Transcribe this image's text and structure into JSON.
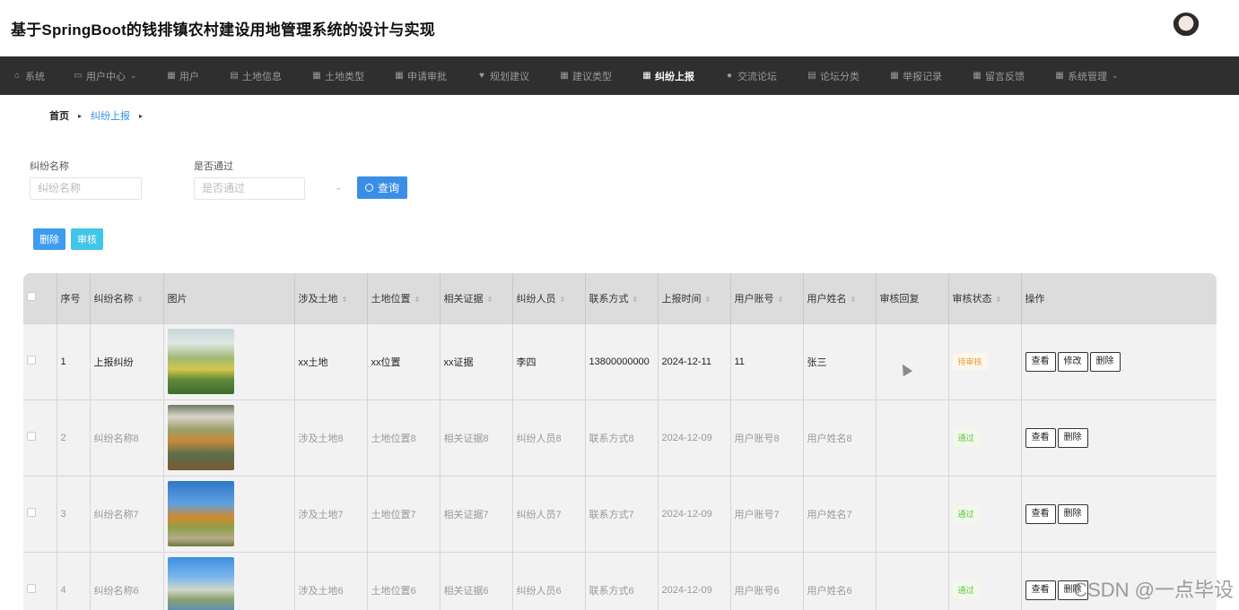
{
  "header": {
    "title": "基于SpringBoot的钱排镇农村建设用地管理系统的设计与实现"
  },
  "nav": [
    {
      "label": "系统",
      "icon": "home-icon",
      "glyph": "⌂"
    },
    {
      "label": "用户中心",
      "icon": "calendar-icon",
      "glyph": "▭",
      "caret": "⌄"
    },
    {
      "label": "用户",
      "icon": "grid-icon",
      "glyph": "▦"
    },
    {
      "label": "土地信息",
      "icon": "clipboard-icon",
      "glyph": "▤"
    },
    {
      "label": "土地类型",
      "icon": "grid-icon",
      "glyph": "▦"
    },
    {
      "label": "申请审批",
      "icon": "grid-icon",
      "glyph": "▦"
    },
    {
      "label": "规划建议",
      "icon": "trophy-icon",
      "glyph": "♥"
    },
    {
      "label": "建议类型",
      "icon": "grid-icon",
      "glyph": "▦"
    },
    {
      "label": "纠纷上报",
      "icon": "grid-icon",
      "glyph": "▦",
      "active": true
    },
    {
      "label": "交流论坛",
      "icon": "user-icon",
      "glyph": "●"
    },
    {
      "label": "论坛分类",
      "icon": "clipboard-icon",
      "glyph": "▤"
    },
    {
      "label": "举报记录",
      "icon": "grid-icon",
      "glyph": "▦"
    },
    {
      "label": "留言反馈",
      "icon": "grid-icon",
      "glyph": "▦"
    },
    {
      "label": "系统管理",
      "icon": "grid-icon",
      "glyph": "▦",
      "caret": "⌄"
    }
  ],
  "breadcrumb": {
    "home": "首页",
    "current": "纠纷上报",
    "sep": "▸"
  },
  "search": {
    "name_label": "纠纷名称",
    "name_placeholder": "纠纷名称",
    "pass_label": "是否通过",
    "pass_placeholder": "是否通过",
    "query_label": "查询"
  },
  "actions": {
    "delete_label": "删除",
    "audit_label": "审核"
  },
  "table": {
    "headers": [
      "序号",
      "纠纷名称",
      "图片",
      "涉及土地",
      "土地位置",
      "相关证据",
      "纠纷人员",
      "联系方式",
      "上报时间",
      "用户账号",
      "用户姓名",
      "审核回复",
      "审核状态",
      "操作"
    ],
    "sort_glyph": "⇕",
    "view_label": "查看",
    "edit_label": "修改",
    "delete_label": "删除",
    "rows": [
      {
        "idx": "1",
        "name": "上报纠纷",
        "land": "xx土地",
        "location": "xx位置",
        "evidence": "xx证据",
        "person": "李四",
        "phone": "13800000000",
        "time": "2024-12-11",
        "account": "11",
        "username": "张三",
        "reply": "",
        "status": "待审核",
        "status_kind": "pending",
        "editable": true,
        "image": "terraced-village-photo"
      },
      {
        "idx": "2",
        "name": "纠纷名称8",
        "land": "涉及土地8",
        "location": "土地位置8",
        "evidence": "相关证据8",
        "person": "纠纷人员8",
        "phone": "联系方式8",
        "time": "2024-12-09",
        "account": "用户账号8",
        "username": "用户姓名8",
        "reply": "",
        "status": "通过",
        "status_kind": "pass",
        "editable": false,
        "image": "river-village-photo"
      },
      {
        "idx": "3",
        "name": "纠纷名称7",
        "land": "涉及土地7",
        "location": "土地位置7",
        "evidence": "相关证据7",
        "person": "纠纷人员7",
        "phone": "联系方式7",
        "time": "2024-12-09",
        "account": "用户账号7",
        "username": "用户姓名7",
        "reply": "",
        "status": "通过",
        "status_kind": "pass",
        "editable": false,
        "image": "autumn-path-photo"
      },
      {
        "idx": "4",
        "name": "纠纷名称6",
        "land": "涉及土地6",
        "location": "土地位置6",
        "evidence": "相关证据6",
        "person": "纠纷人员6",
        "phone": "联系方式6",
        "time": "2024-12-09",
        "account": "用户账号6",
        "username": "用户姓名6",
        "reply": "",
        "status": "通过",
        "status_kind": "pass",
        "editable": false,
        "image": "canal-house-photo"
      }
    ]
  },
  "watermark": "CSDN @一点毕设"
}
